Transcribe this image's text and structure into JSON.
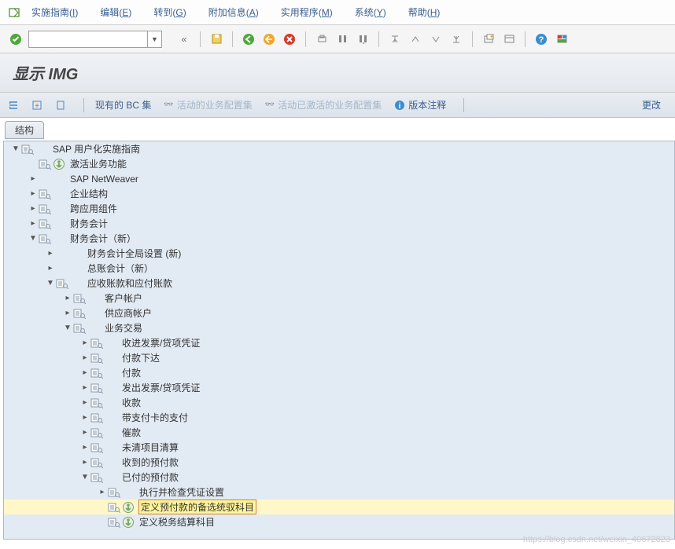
{
  "menu": {
    "items": [
      {
        "label": "实施指南",
        "accel": "I"
      },
      {
        "label": "编辑",
        "accel": "E"
      },
      {
        "label": "转到",
        "accel": "G"
      },
      {
        "label": "附加信息",
        "accel": "A"
      },
      {
        "label": "实用程序",
        "accel": "M"
      },
      {
        "label": "系统",
        "accel": "Y"
      },
      {
        "label": "帮助",
        "accel": "H"
      }
    ]
  },
  "header_title": "显示 IMG",
  "toolbar2": {
    "bc_set": "现有的 BC 集",
    "active_bc": "活动的业务配置集",
    "activated_bc": "活动已激活的业务配置集",
    "release_notes": "版本注释",
    "change": "更改"
  },
  "structure_label": "结构",
  "tree": [
    {
      "depth": 0,
      "exp": "open",
      "icons": [
        "doc"
      ],
      "text": "SAP 用户化实施指南"
    },
    {
      "depth": 1,
      "exp": "none",
      "icons": [
        "doc",
        "exec"
      ],
      "text": "激活业务功能"
    },
    {
      "depth": 1,
      "exp": "closed",
      "icons": [],
      "text": "SAP NetWeaver"
    },
    {
      "depth": 1,
      "exp": "closed",
      "icons": [
        "doc"
      ],
      "text": "企业结构"
    },
    {
      "depth": 1,
      "exp": "closed",
      "icons": [
        "doc"
      ],
      "text": "跨应用组件"
    },
    {
      "depth": 1,
      "exp": "closed",
      "icons": [
        "doc"
      ],
      "text": "财务会计"
    },
    {
      "depth": 1,
      "exp": "open",
      "icons": [
        "doc"
      ],
      "text": "财务会计（新）"
    },
    {
      "depth": 2,
      "exp": "closed",
      "icons": [],
      "text": "财务会计全局设置 (新)"
    },
    {
      "depth": 2,
      "exp": "closed",
      "icons": [],
      "text": "总账会计（新）"
    },
    {
      "depth": 2,
      "exp": "open",
      "icons": [
        "doc"
      ],
      "text": "应收账款和应付账款"
    },
    {
      "depth": 3,
      "exp": "closed",
      "icons": [
        "doc"
      ],
      "text": "客户帐户"
    },
    {
      "depth": 3,
      "exp": "closed",
      "icons": [
        "doc"
      ],
      "text": "供应商帐户"
    },
    {
      "depth": 3,
      "exp": "open",
      "icons": [
        "doc"
      ],
      "text": "业务交易"
    },
    {
      "depth": 4,
      "exp": "closed",
      "icons": [
        "doc"
      ],
      "text": "收进发票/贷项凭证"
    },
    {
      "depth": 4,
      "exp": "closed",
      "icons": [
        "doc"
      ],
      "text": "付款下达"
    },
    {
      "depth": 4,
      "exp": "closed",
      "icons": [
        "doc"
      ],
      "text": "付款"
    },
    {
      "depth": 4,
      "exp": "closed",
      "icons": [
        "doc"
      ],
      "text": "发出发票/贷项凭证"
    },
    {
      "depth": 4,
      "exp": "closed",
      "icons": [
        "doc"
      ],
      "text": "收款"
    },
    {
      "depth": 4,
      "exp": "closed",
      "icons": [
        "doc"
      ],
      "text": "带支付卡的支付"
    },
    {
      "depth": 4,
      "exp": "closed",
      "icons": [
        "doc"
      ],
      "text": "催款"
    },
    {
      "depth": 4,
      "exp": "closed",
      "icons": [
        "doc"
      ],
      "text": "未清项目清算"
    },
    {
      "depth": 4,
      "exp": "closed",
      "icons": [
        "doc"
      ],
      "text": "收到的预付款"
    },
    {
      "depth": 4,
      "exp": "open",
      "icons": [
        "doc"
      ],
      "text": "已付的预付款"
    },
    {
      "depth": 5,
      "exp": "closed",
      "icons": [
        "doc"
      ],
      "text": "执行并检查凭证设置"
    },
    {
      "depth": 5,
      "exp": "none",
      "icons": [
        "doc",
        "exec"
      ],
      "text": "定义预付款的备选统驭科目",
      "highlight": true
    },
    {
      "depth": 5,
      "exp": "none",
      "icons": [
        "doc",
        "exec"
      ],
      "text": "定义税务结算科目"
    }
  ],
  "watermark": "https://blog.csdn.net/weixin_40672823"
}
